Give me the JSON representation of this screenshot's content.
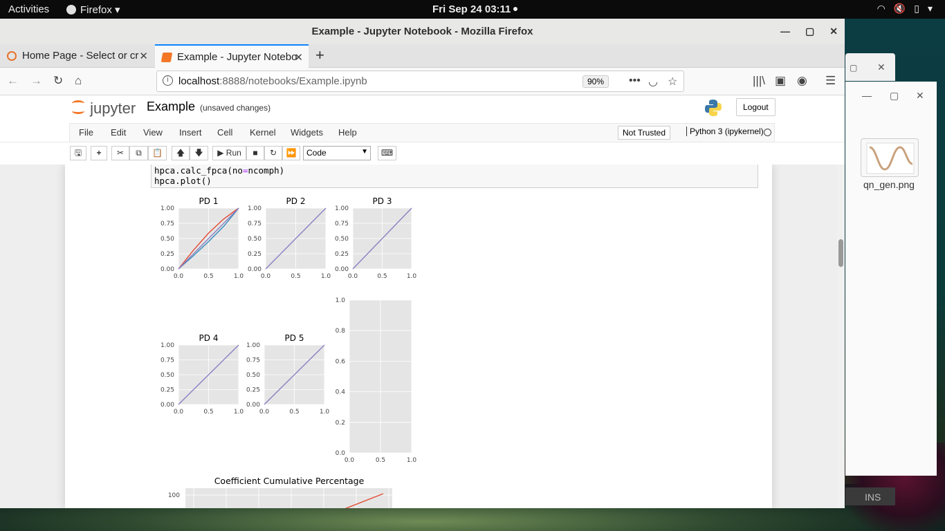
{
  "topbar": {
    "activities": "Activities",
    "app_name": "Firefox",
    "clock": "Fri Sep 24  03:11"
  },
  "window": {
    "title": "Example - Jupyter Notebook - Mozilla Firefox"
  },
  "tabs": [
    {
      "label": "Home Page - Select or cr"
    },
    {
      "label": "Example - Jupyter Notebo"
    }
  ],
  "urlbar": {
    "host": "localhost",
    "path": ":8888/notebooks/Example.ipynb",
    "zoom": "90%"
  },
  "jupyter": {
    "logo_text": "jupyter",
    "notebook_name": "Example",
    "autosave": "(unsaved changes)",
    "logout": "Logout",
    "menu": [
      "File",
      "Edit",
      "View",
      "Insert",
      "Cell",
      "Kernel",
      "Widgets",
      "Help"
    ],
    "trusted": "Not Trusted",
    "kernel": "Python 3 (ipykernel)",
    "run_label": "Run",
    "cell_type": "Code"
  },
  "code_cell": {
    "line1_a": "hpca.calc_fpca(no",
    "line1_eq": "=",
    "line1_b": "ncomph)",
    "line2": "hpca.plot()"
  },
  "side_window": {
    "filename": "qn_gen.png",
    "status": "INS"
  },
  "colors": {
    "plot_bg": "#e5e5e5",
    "line_purple": "#8b7fc2",
    "line_red": "#e24a33",
    "line_blue": "#348abd"
  },
  "chart_data": [
    {
      "type": "line",
      "title": "PD 1",
      "xlim": [
        0,
        1
      ],
      "ylim": [
        0,
        1
      ],
      "xticks": [
        "0.0",
        "0.5",
        "1.0"
      ],
      "yticks": [
        "0.00",
        "0.25",
        "0.50",
        "0.75",
        "1.00"
      ],
      "series": [
        {
          "x": [
            0,
            0.25,
            0.5,
            0.75,
            1
          ],
          "y": [
            0,
            0.31,
            0.59,
            0.82,
            1
          ],
          "color": "red"
        },
        {
          "x": [
            0,
            0.25,
            0.5,
            0.75,
            1
          ],
          "y": [
            0,
            0.22,
            0.45,
            0.7,
            1
          ],
          "color": "blue"
        },
        {
          "x": [
            0,
            0.25,
            0.5,
            0.75,
            1
          ],
          "y": [
            0,
            0.25,
            0.5,
            0.75,
            1
          ],
          "color": "purple"
        }
      ]
    },
    {
      "type": "line",
      "title": "PD 2",
      "xlim": [
        0,
        1
      ],
      "ylim": [
        0,
        1
      ],
      "xticks": [
        "0.0",
        "0.5",
        "1.0"
      ],
      "yticks": [
        "0.00",
        "0.25",
        "0.50",
        "0.75",
        "1.00"
      ],
      "series": [
        {
          "x": [
            0,
            1
          ],
          "y": [
            0,
            1
          ],
          "color": "purple"
        }
      ]
    },
    {
      "type": "line",
      "title": "PD 3",
      "xlim": [
        0,
        1
      ],
      "ylim": [
        0,
        1
      ],
      "xticks": [
        "0.0",
        "0.5",
        "1.0"
      ],
      "yticks": [
        "0.00",
        "0.25",
        "0.50",
        "0.75",
        "1.00"
      ],
      "series": [
        {
          "x": [
            0,
            1
          ],
          "y": [
            0,
            1
          ],
          "color": "purple"
        }
      ]
    },
    {
      "type": "line",
      "title": "PD 4",
      "xlim": [
        0,
        1
      ],
      "ylim": [
        0,
        1
      ],
      "xticks": [
        "0.0",
        "0.5",
        "1.0"
      ],
      "yticks": [
        "0.00",
        "0.25",
        "0.50",
        "0.75",
        "1.00"
      ],
      "series": [
        {
          "x": [
            0,
            1
          ],
          "y": [
            0,
            1
          ],
          "color": "purple"
        }
      ]
    },
    {
      "type": "line",
      "title": "PD 5",
      "xlim": [
        0,
        1
      ],
      "ylim": [
        0,
        1
      ],
      "xticks": [
        "0.0",
        "0.5",
        "1.0"
      ],
      "yticks": [
        "0.00",
        "0.25",
        "0.50",
        "0.75",
        "1.00"
      ],
      "series": [
        {
          "x": [
            0,
            1
          ],
          "y": [
            0,
            1
          ],
          "color": "purple"
        }
      ]
    },
    {
      "type": "line",
      "title": "",
      "xlim": [
        0,
        1
      ],
      "ylim": [
        0,
        1
      ],
      "xticks": [
        "0.0",
        "0.5",
        "1.0"
      ],
      "yticks": [
        "0.0",
        "0.2",
        "0.4",
        "0.6",
        "0.8",
        "1.0"
      ],
      "series": []
    },
    {
      "type": "line",
      "title": "Coefficient Cumulative Percentage",
      "yticks": [
        "100"
      ],
      "series": [
        {
          "color": "red"
        }
      ]
    }
  ]
}
